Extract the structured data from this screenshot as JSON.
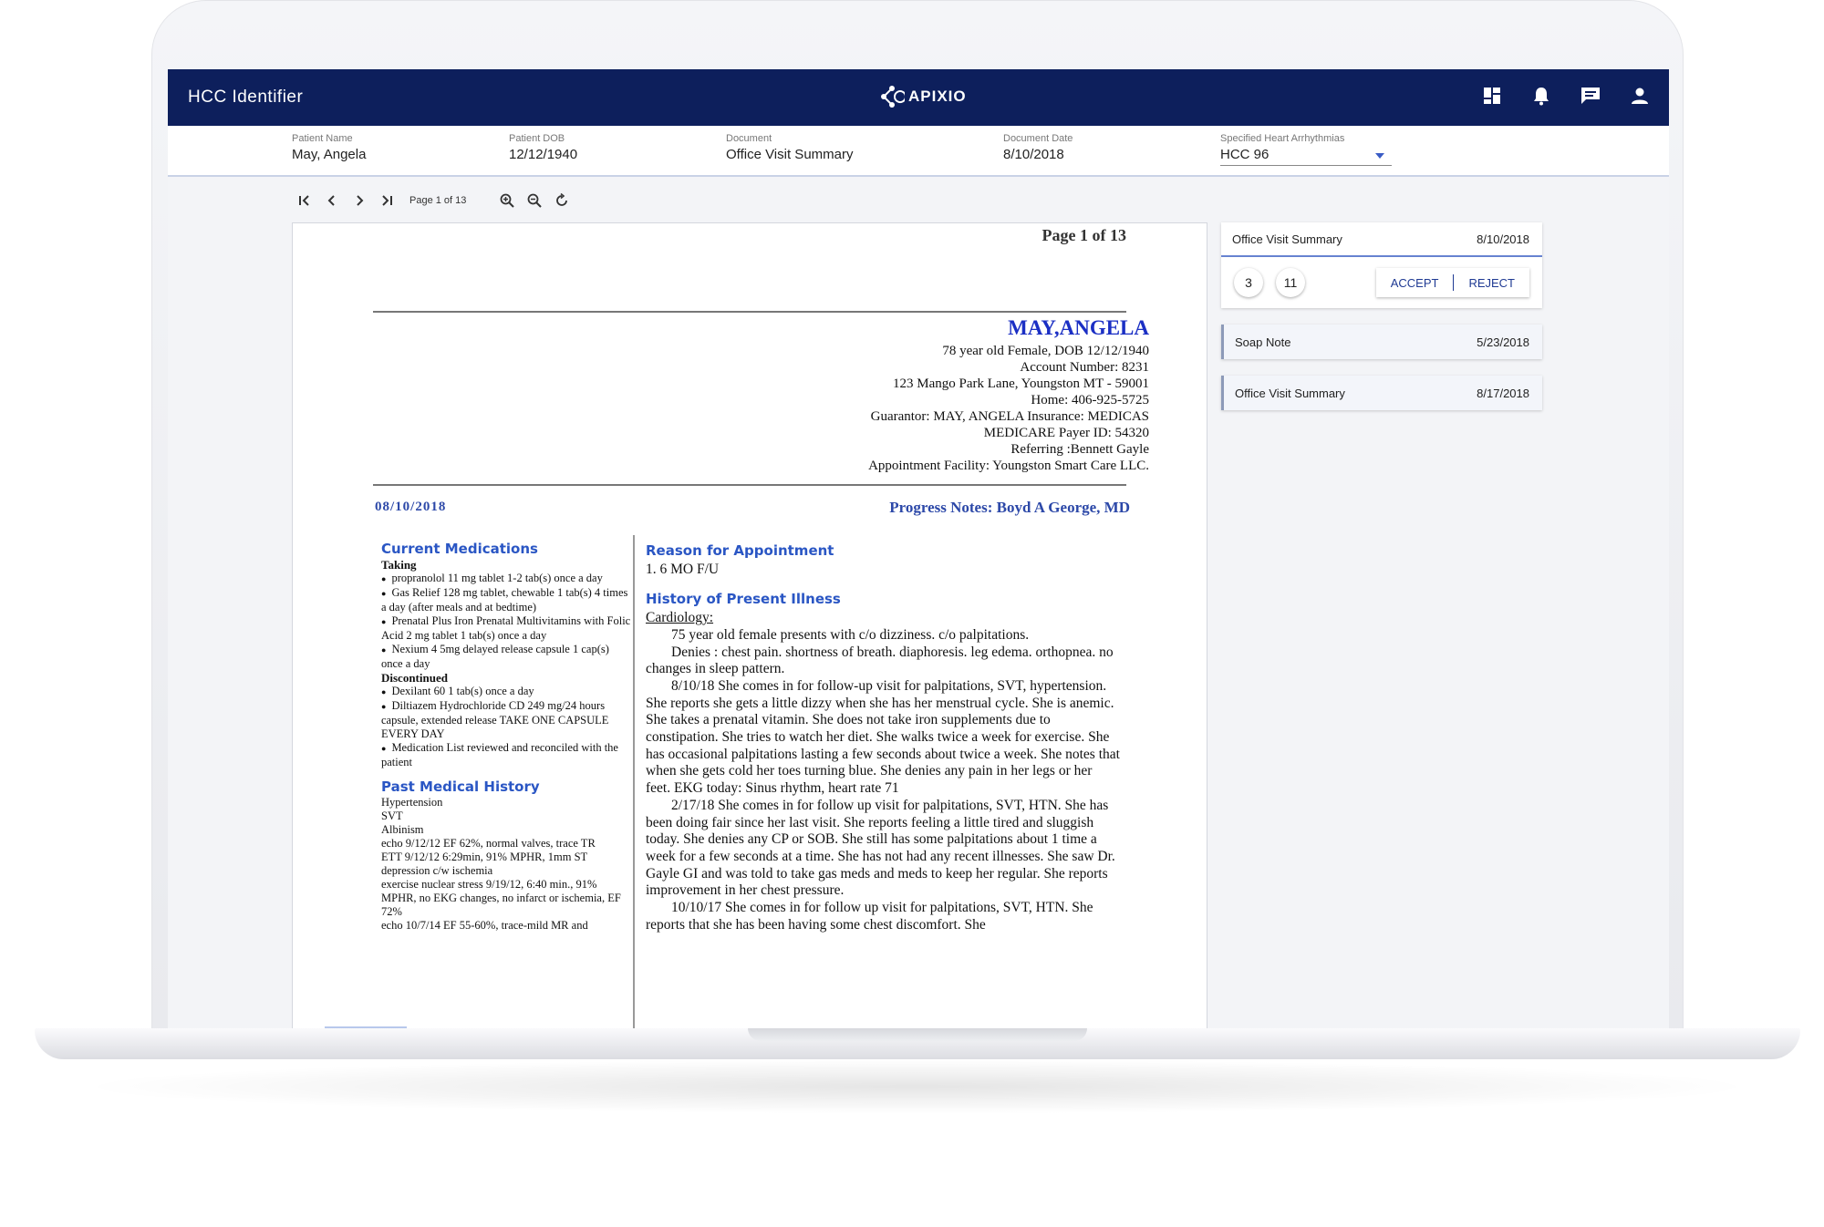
{
  "app": {
    "title": "HCC Identifier",
    "logo_text": "APIXIO"
  },
  "header_icons": [
    "dashboard-icon",
    "notifications-icon",
    "chat-icon",
    "account-icon"
  ],
  "patient": {
    "name_label": "Patient Name",
    "name": "May, Angela",
    "dob_label": "Patient DOB",
    "dob": "12/12/1940",
    "doc_label": "Document",
    "doc": "Office Visit Summary",
    "date_label": "Document Date",
    "date": "8/10/2018",
    "hcc_label": "Specified Heart Arrhythmias",
    "hcc": "HCC 96"
  },
  "toolbar": {
    "page_indicator": "Page 1 of 13"
  },
  "document": {
    "page_heading": "Page 1 of 13",
    "patient_name": "MAY,ANGELA",
    "header_lines": [
      "78  year old Female, DOB 12/12/1940",
      "Account Number: 8231",
      "123 Mango Park Lane, Youngston MT - 59001",
      "Home: 406-925-5725",
      "Guarantor: MAY, ANGELA Insurance: MEDICAS",
      "MEDICARE Payer ID: 54320",
      "Referring :Bennett Gayle",
      "Appointment Facility: Youngston Smart Care LLC."
    ],
    "visit_date": "08/10/2018",
    "progress_notes": "Progress Notes:  Boyd A George, MD",
    "meds_heading": "Current Medications",
    "taking_label": "Taking",
    "taking": [
      "propranolol 11 mg tablet 1-2 tab(s) once a day",
      "Gas Relief 128 mg tablet, chewable 1 tab(s) 4 times a day (after meals and at bedtime)",
      "Prenatal Plus Iron Prenatal Multivitamins with Folic Acid 2 mg tablet 1 tab(s) once a day",
      "Nexium 4 5mg delayed release capsule 1 cap(s) once a day"
    ],
    "discontinued_label": "Discontinued",
    "discontinued": [
      "Dexilant 60 1 tab(s) once a day",
      "Diltiazem Hydrochloride CD 249 mg/24 hours capsule, extended release TAKE ONE CAPSULE EVERY DAY",
      "Medication List reviewed and reconciled with the patient"
    ],
    "pmh_heading": "Past Medical History",
    "pmh": [
      "Hypertension",
      "SVT",
      "Albinism",
      "echo 9/12/12 EF 62%, normal valves, trace TR",
      "ETT 9/12/12 6:29min, 91% MPHR, 1mm ST depression c/w ischemia",
      "exercise nuclear stress 9/19/12, 6:40 min., 91% MPHR, no EKG changes, no infarct or ischemia, EF 72%",
      "echo 10/7/14 EF 55-60%, trace-mild MR and"
    ],
    "reason_heading": "Reason for Appointment",
    "reason": "1. 6 MO F/U",
    "hpi_heading": "History of Present Illness",
    "hpi_sub": "Cardiology:",
    "hpi_paragraphs": [
      "75 year old female presents with c/o dizziness.  c/o palpitations.",
      "Denies : chest pain. shortness of breath. diaphoresis. leg edema. orthopnea. no changes in sleep pattern.",
      "8/10/18 She comes in for follow-up visit for palpitations, SVT, hypertension. She reports she gets a little dizzy when she has her menstrual cycle. She is anemic. She takes a prenatal vitamin. She does not take iron supplements due to constipation. She tries to watch her diet. She walks twice a week for exercise. She has occasional palpitations lasting a few seconds about twice a week. She notes that when she gets cold her toes turning blue. She denies any pain in her legs or her feet. EKG today: Sinus rhythm, heart rate 71",
      "2/17/18 She comes in for follow up visit for palpitations, SVT, HTN. She has been doing fair since her last visit. She reports feeling a little tired and sluggish today. She denies any CP or SOB. She still has some palpitations about 1 time a week for a few seconds at a time. She has not had any recent illnesses. She saw Dr. Gayle GI and was told to take gas meds and meds to keep her regular. She reports improvement in her chest pressure.",
      "10/10/17 She comes in for follow up visit for palpitations, SVT, HTN. She reports that she has been having some chest discomfort. She"
    ]
  },
  "documents_panel": {
    "active": {
      "title": "Office Visit Summary",
      "date": "8/10/2018",
      "count_a": "3",
      "count_b": "11",
      "accept": "ACCEPT",
      "reject": "REJECT"
    },
    "others": [
      {
        "title": "Soap Note",
        "date": "5/23/2018"
      },
      {
        "title": "Office Visit Summary",
        "date": "8/17/2018"
      }
    ]
  },
  "colors": {
    "header_bg": "#0d1f5c",
    "accent": "#2a56c4",
    "patient_name": "#1b2fc4"
  }
}
